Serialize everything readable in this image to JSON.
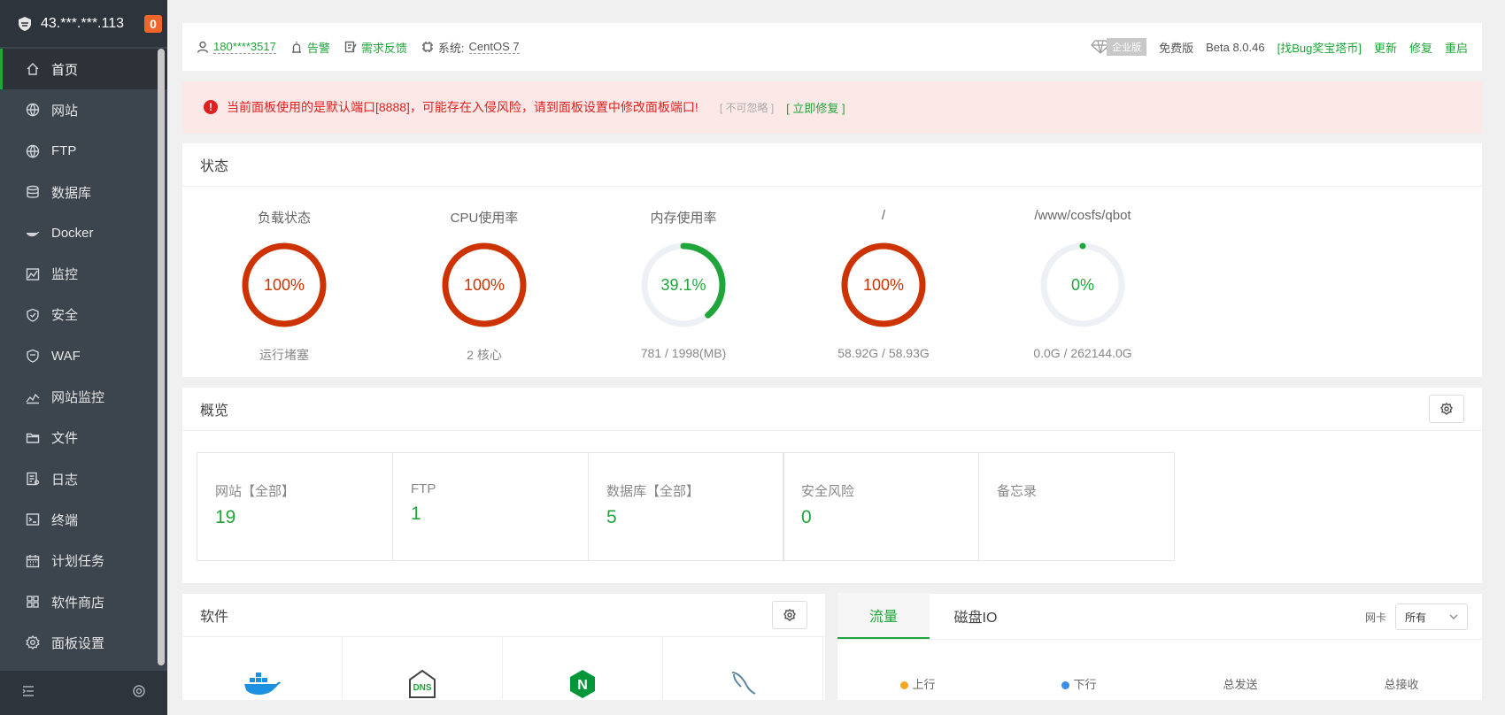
{
  "sidebar": {
    "server": "43.***.***.113",
    "badge": "0",
    "items": [
      {
        "label": "首页",
        "icon": "home-icon",
        "active": true
      },
      {
        "label": "网站",
        "icon": "globe-icon"
      },
      {
        "label": "FTP",
        "icon": "ftp-globe-icon"
      },
      {
        "label": "数据库",
        "icon": "database-icon"
      },
      {
        "label": "Docker",
        "icon": "docker-icon"
      },
      {
        "label": "监控",
        "icon": "monitor-icon"
      },
      {
        "label": "安全",
        "icon": "shield-icon"
      },
      {
        "label": "WAF",
        "icon": "waf-shield-icon"
      },
      {
        "label": "网站监控",
        "icon": "chart-icon"
      },
      {
        "label": "文件",
        "icon": "folder-icon"
      },
      {
        "label": "日志",
        "icon": "log-icon"
      },
      {
        "label": "终端",
        "icon": "terminal-icon"
      },
      {
        "label": "计划任务",
        "icon": "calendar-icon"
      },
      {
        "label": "软件商店",
        "icon": "grid-icon"
      },
      {
        "label": "面板设置",
        "icon": "gear-icon"
      }
    ]
  },
  "topbar": {
    "user": "180****3517",
    "alarm": "告警",
    "feedback": "需求反馈",
    "sys_label": "系统:",
    "sys_value": "CentOS 7",
    "enterprise": "企业版",
    "free": "免费版",
    "version": "Beta 8.0.46",
    "bug": "[找Bug奖宝塔币]",
    "update": "更新",
    "repair": "修复",
    "restart": "重启"
  },
  "alert": {
    "text": "当前面板使用的是默认端口[8888]，可能存在入侵风险，请到面板设置中修改面板端口!",
    "ignore": "[ 不可忽略 ]",
    "fix": "[ 立即修复 ]"
  },
  "status": {
    "title": "状态",
    "gauges": [
      {
        "title": "负载状态",
        "value": "100%",
        "pct": 100,
        "sub": "运行堵塞",
        "color": "#cc3300"
      },
      {
        "title": "CPU使用率",
        "value": "100%",
        "pct": 100,
        "sub": "2 核心",
        "color": "#cc3300"
      },
      {
        "title": "内存使用率",
        "value": "39.1%",
        "pct": 39.1,
        "sub": "781 / 1998(MB)",
        "color": "#20a53a"
      },
      {
        "title": "/",
        "value": "100%",
        "pct": 100,
        "sub": "58.92G / 58.93G",
        "color": "#cc3300"
      },
      {
        "title": "/www/cosfs/qbot",
        "value": "0%",
        "pct": 0,
        "sub": "0.0G / 262144.0G",
        "color": "#20a53a"
      }
    ]
  },
  "overview": {
    "title": "概览",
    "boxes": [
      {
        "label": "网站【全部】",
        "value": "19"
      },
      {
        "label": "FTP",
        "value": "1"
      },
      {
        "label": "数据库【全部】",
        "value": "5"
      },
      {
        "label": "安全风险",
        "value": "0"
      },
      {
        "label": "备忘录",
        "value": ""
      }
    ]
  },
  "software": {
    "title": "软件",
    "dns": "DNS",
    "nginx": "N"
  },
  "traffic": {
    "tabs": [
      "流量",
      "磁盘IO"
    ],
    "nic_label": "网卡",
    "nic_value": "所有",
    "legend": [
      "上行",
      "下行",
      "总发送",
      "总接收"
    ]
  }
}
